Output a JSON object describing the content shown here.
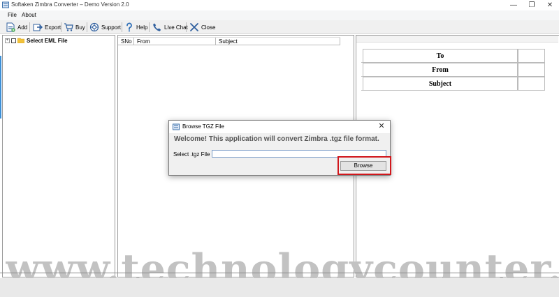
{
  "window": {
    "title": "Softaken Zimbra Converter – Demo Version 2.0",
    "minimize_glyph": "—",
    "restore_glyph": "❐",
    "close_glyph": "✕"
  },
  "menu": {
    "file": "File",
    "about": "About"
  },
  "toolbar": {
    "add": "Add",
    "export": "Export",
    "buy": "Buy",
    "support": "Support",
    "help": "Help",
    "live_chat": "Live Chat",
    "close": "Close"
  },
  "tree": {
    "expand_glyph": "+",
    "root_label": "Select EML File"
  },
  "grid": {
    "columns": [
      "SNo",
      "From",
      "Subject"
    ]
  },
  "header_fields": {
    "to": "To",
    "from": "From",
    "subject": "Subject"
  },
  "dialog": {
    "title": "Browse TGZ File",
    "close_glyph": "✕",
    "welcome": "Welcome! This application will convert Zimbra .tgz file format.",
    "field_label": "Select .tgz File",
    "field_value": "",
    "browse_label": "Browse"
  },
  "watermark": {
    "text": "www.technologycounter.com"
  },
  "colors": {
    "highlight": "#d1171c",
    "accent_blue": "#3b8fd7",
    "toolbar_bg": "#f0f0f0"
  },
  "icons": {
    "add": "add-file-icon",
    "export": "export-icon",
    "buy": "cart-icon",
    "support": "support-icon",
    "help": "question-icon",
    "live_chat": "phone-icon",
    "close": "close-x-icon"
  }
}
